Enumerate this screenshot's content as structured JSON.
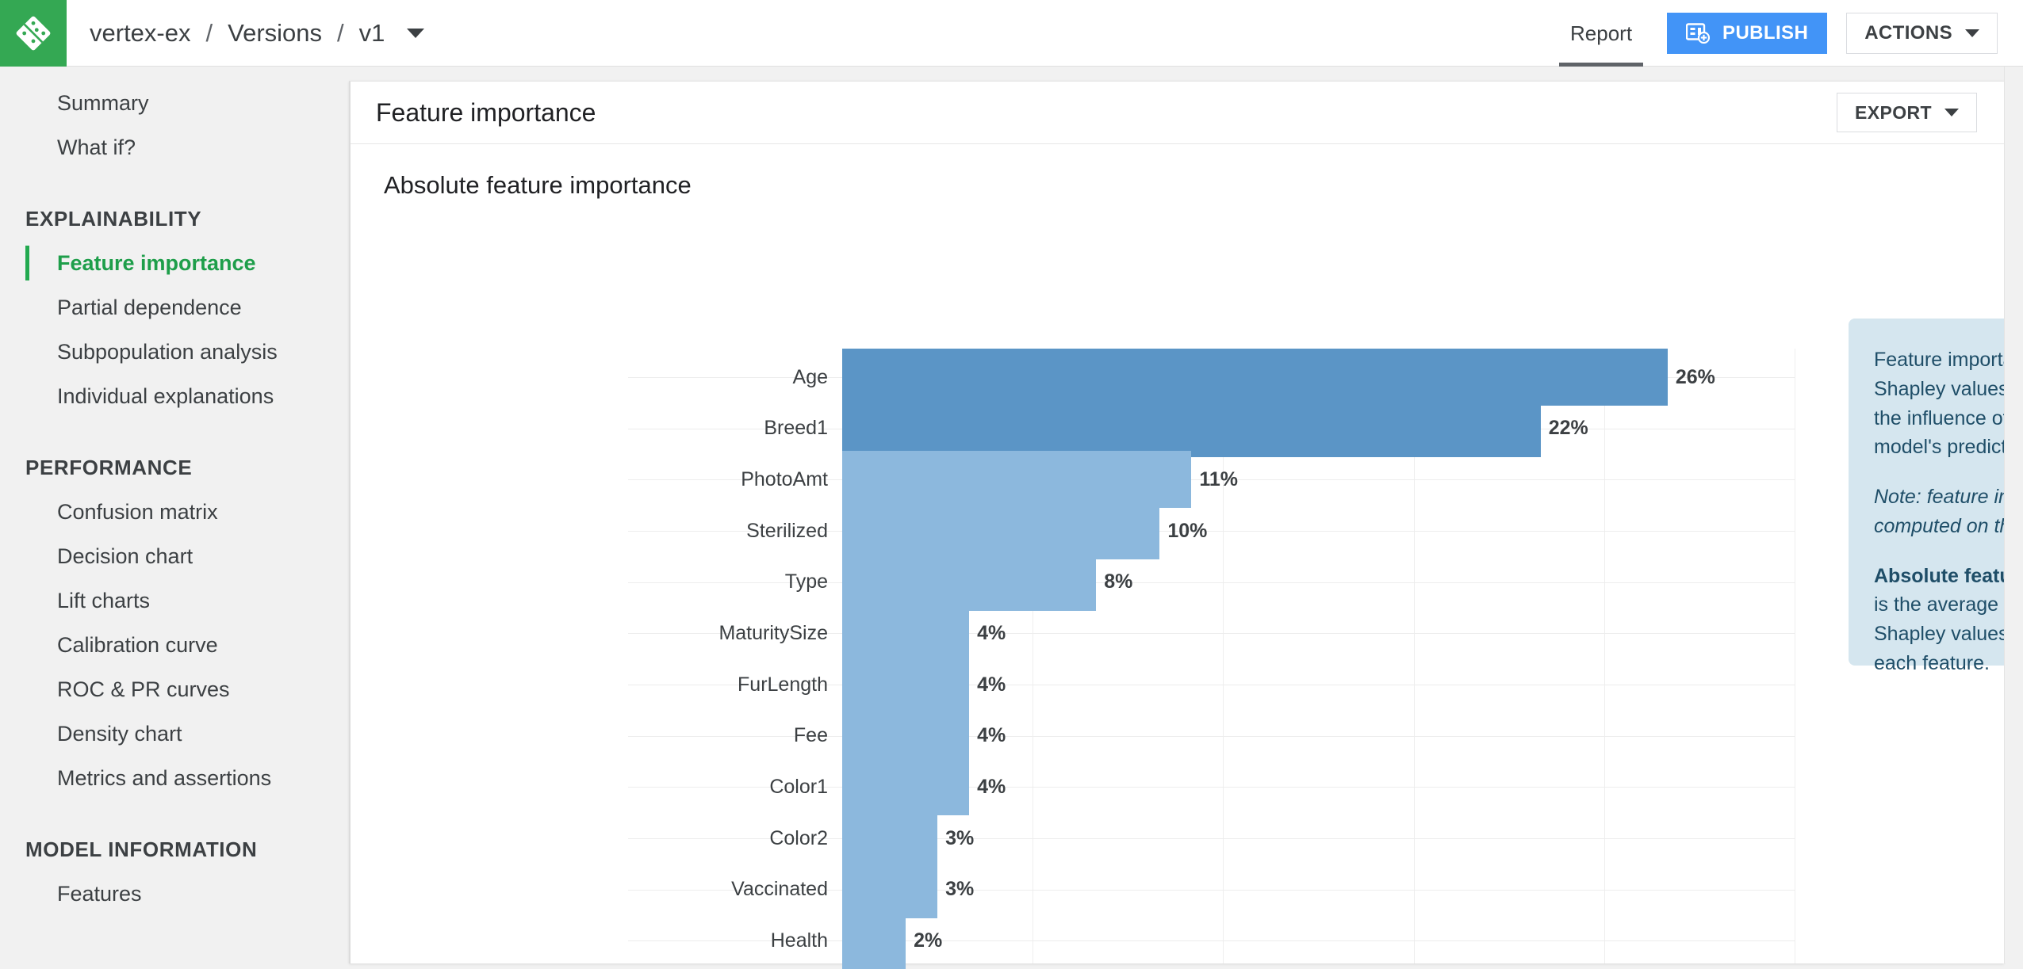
{
  "header": {
    "logo_icon": "domino-logo-icon",
    "breadcrumb": [
      {
        "label": "vertex-ex"
      },
      {
        "label": "Versions"
      },
      {
        "label": "v1"
      }
    ],
    "separator": "/",
    "version_caret_icon": "chevron-down-icon",
    "report_tab": "Report",
    "publish_label": "PUBLISH",
    "publish_icon": "publish-report-icon",
    "publish_color": "#4294f7",
    "actions_label": "ACTIONS",
    "actions_caret_icon": "chevron-down-icon",
    "brand_green": "#34a853"
  },
  "sidebar": {
    "top_items": [
      {
        "label": "Summary",
        "active": false
      },
      {
        "label": "What if?",
        "active": false
      }
    ],
    "groups": [
      {
        "title": "EXPLAINABILITY",
        "items": [
          {
            "label": "Feature importance",
            "active": true
          },
          {
            "label": "Partial dependence",
            "active": false
          },
          {
            "label": "Subpopulation analysis",
            "active": false
          },
          {
            "label": "Individual explanations",
            "active": false
          }
        ]
      },
      {
        "title": "PERFORMANCE",
        "items": [
          {
            "label": "Confusion matrix",
            "active": false
          },
          {
            "label": "Decision chart",
            "active": false
          },
          {
            "label": "Lift charts",
            "active": false
          },
          {
            "label": "Calibration curve",
            "active": false
          },
          {
            "label": "ROC & PR curves",
            "active": false
          },
          {
            "label": "Density chart",
            "active": false
          },
          {
            "label": "Metrics and assertions",
            "active": false
          }
        ]
      },
      {
        "title": "MODEL INFORMATION",
        "items": [
          {
            "label": "Features",
            "active": false
          }
        ]
      }
    ],
    "active_color": "#1e9e4a"
  },
  "card": {
    "title": "Feature importance",
    "export_label": "EXPORT",
    "export_caret_icon": "chevron-down-icon"
  },
  "info_panel": {
    "paragraph_1": "Feature importance is based on Shapley values, which estimate the influence of features on a model's prediction.",
    "note": "Note: feature importance is computed on the test dataset.",
    "definition_term": "Absolute feature importance",
    "definition_rest": " is the average of absolute Shapley values computed for each feature.",
    "background": "#d5e6ef",
    "text_color": "#1f4e68"
  },
  "thumbnails": [
    {
      "name": "bar-chart-thumbnail",
      "selected": true
    },
    {
      "name": "strip-plot-thumbnail",
      "selected": false
    },
    {
      "name": "scatter-plot-thumbnail",
      "selected": false
    }
  ],
  "chart_data": {
    "type": "bar",
    "orientation": "horizontal",
    "title": "Absolute feature importance",
    "xlabel": "",
    "ylabel": "",
    "xlim": [
      0,
      30
    ],
    "grid": true,
    "value_suffix": "%",
    "gridline_values": [
      0,
      6,
      12,
      18,
      24,
      30
    ],
    "bar_color_dark": "#5b95c6",
    "bar_color_light": "#8cb8dd",
    "categories": [
      "Age",
      "Breed1",
      "PhotoAmt",
      "Sterilized",
      "Type",
      "MaturitySize",
      "FurLength",
      "Fee",
      "Color1",
      "Color2",
      "Vaccinated",
      "Health"
    ],
    "values": [
      26,
      22,
      11,
      10,
      8,
      4,
      4,
      4,
      4,
      3,
      3,
      2
    ],
    "labels": [
      "26%",
      "22%",
      "11%",
      "10%",
      "8%",
      "4%",
      "4%",
      "4%",
      "4%",
      "3%",
      "3%",
      "2%"
    ],
    "dark_indices": [
      0,
      1
    ]
  }
}
